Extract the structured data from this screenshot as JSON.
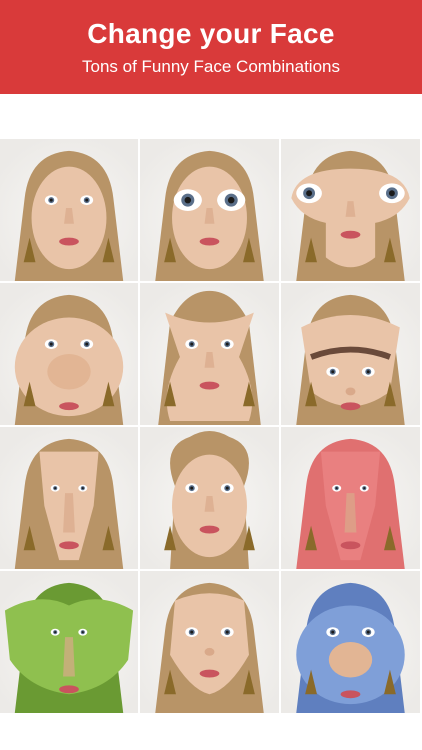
{
  "header": {
    "title": "Change your Face",
    "subtitle": "Tons of Funny Face Combinations",
    "background": "#d93a3a"
  },
  "grid": {
    "tiles": [
      {
        "tint": "#e9c4a8",
        "hair": "#b89467",
        "warp": "normal",
        "eyes": "normal",
        "nose": "normal"
      },
      {
        "tint": "#e9c4a8",
        "hair": "#b89467",
        "warp": "bigeyes",
        "eyes": "big",
        "nose": "normal"
      },
      {
        "tint": "#e9c4a8",
        "hair": "#b89467",
        "warp": "wide-eyes",
        "eyes": "wide",
        "nose": "normal"
      },
      {
        "tint": "#e9c4a8",
        "hair": "#b89467",
        "warp": "bignose",
        "eyes": "normal",
        "nose": "big"
      },
      {
        "tint": "#e9c4a8",
        "hair": "#b89467",
        "warp": "hourglass",
        "eyes": "normal",
        "nose": "normal"
      },
      {
        "tint": "#e9c4a8",
        "hair": "#b89467",
        "warp": "squash-top",
        "eyes": "normal",
        "nose": "small"
      },
      {
        "tint": "#e9c4a8",
        "hair": "#b89467",
        "warp": "narrow",
        "eyes": "small",
        "nose": "long"
      },
      {
        "tint": "#e9c4a8",
        "hair": "#b89467",
        "warp": "tall-hair",
        "eyes": "normal",
        "nose": "normal"
      },
      {
        "tint": "#e98080",
        "hair": "#e07070",
        "warp": "narrow",
        "eyes": "small",
        "nose": "long"
      },
      {
        "tint": "#8fc04f",
        "hair": "#6a9a33",
        "warp": "wavy",
        "eyes": "small",
        "nose": "long"
      },
      {
        "tint": "#e9c4a8",
        "hair": "#b89467",
        "warp": "squash-bottom",
        "eyes": "normal",
        "nose": "small"
      },
      {
        "tint": "#7f9fd8",
        "hair": "#5f7fbf",
        "warp": "bignose",
        "eyes": "normal",
        "nose": "big"
      }
    ]
  }
}
